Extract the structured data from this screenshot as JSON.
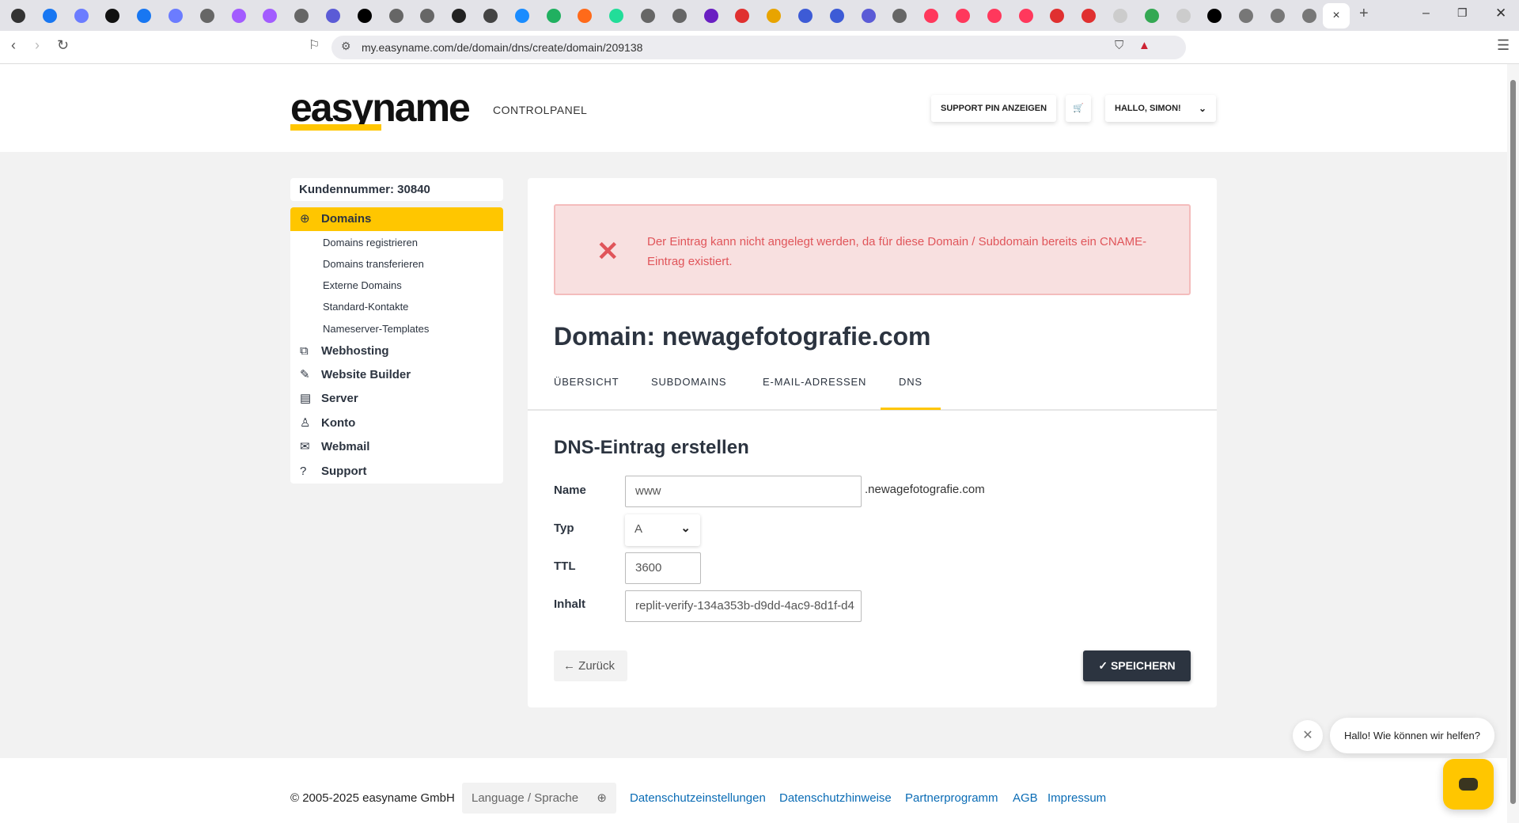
{
  "browser": {
    "url": "my.easyname.com/de/domain/dns/create/domain/209138",
    "active_tab_close": "×",
    "new_tab": "+",
    "tab_icon_colors": [
      "#333",
      "#1877f2",
      "#6b7cff",
      "#111",
      "#1877f2",
      "#6b7cff",
      "#666",
      "#a35cff",
      "#a35cff",
      "#666",
      "#5b5bd6",
      "#000",
      "#666",
      "#666",
      "#222",
      "#444",
      "#1a8cff",
      "#20b060",
      "#ff6a1a",
      "#22dd99",
      "#666",
      "#666",
      "#6a1fc2",
      "#e03030",
      "#e8a400",
      "#3d5bd6",
      "#3d5bd6",
      "#5b5bd6",
      "#666",
      "#ff385c",
      "#ff385c",
      "#ff385c",
      "#ff385c",
      "#e03030",
      "#e03030",
      "#ccc",
      "#34a853",
      "#ccc",
      "#000",
      "#777",
      "#777",
      "#777"
    ]
  },
  "header": {
    "logo": "easyname",
    "subtitle": "CONTROLPANEL",
    "support_pin": "SUPPORT PIN ANZEIGEN",
    "cart_icon": "🛒",
    "user_menu": "HALLO, SIMON!"
  },
  "sidebar": {
    "customer_number": "Kundennummer: 30840",
    "items": [
      {
        "label": "Domains",
        "icon": "⊕"
      },
      {
        "label": "Webhosting",
        "icon": "⧉"
      },
      {
        "label": "Website Builder",
        "icon": "✎"
      },
      {
        "label": "Server",
        "icon": "▤"
      },
      {
        "label": "Konto",
        "icon": "♙"
      },
      {
        "label": "Webmail",
        "icon": "✉"
      },
      {
        "label": "Support",
        "icon": "?"
      }
    ],
    "subitems": [
      "Domains registrieren",
      "Domains transferieren",
      "Externe Domains",
      "Standard-Kontakte",
      "Nameserver-Templates"
    ]
  },
  "main": {
    "error": "Der Eintrag kann nicht angelegt werden, da für diese Domain / Subdomain bereits ein CNAME-Eintrag existiert.",
    "title": "Domain: newagefotografie.com",
    "tabs": [
      "ÜBERSICHT",
      "SUBDOMAINS",
      "E-MAIL-ADRESSEN",
      "DNS"
    ],
    "form_title": "DNS-Eintrag erstellen",
    "form": {
      "name_label": "Name",
      "name_value": "www",
      "name_suffix": ".newagefotografie.com",
      "type_label": "Typ",
      "type_value": "A",
      "ttl_label": "TTL",
      "ttl_value": "3600",
      "content_label": "Inhalt",
      "content_value": "replit-verify-134a353b-d9dd-4ac9-8d1f-d4"
    },
    "back": "Zurück",
    "save": "SPEICHERN"
  },
  "footer": {
    "copyright": "© 2005-2025 easyname GmbH",
    "language": "Language / Sprache",
    "links": [
      "Datenschutzeinstellungen",
      "Datenschutzhinweise",
      "Partnerprogramm",
      "AGB",
      "Impressum"
    ]
  },
  "chat": {
    "message": "Hallo! Wie können wir helfen?"
  }
}
